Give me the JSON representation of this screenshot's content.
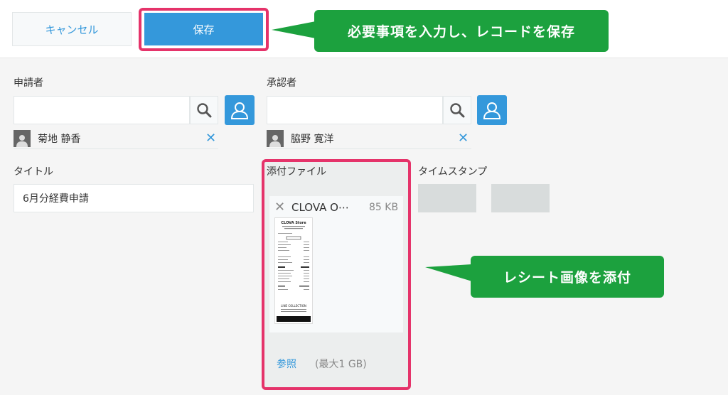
{
  "toolbar": {
    "cancel_label": "キャンセル",
    "save_label": "保存"
  },
  "callouts": {
    "save_note": "必要事項を入力し、レコードを保存",
    "receipt_note": "レシート画像を添付"
  },
  "fields": {
    "applicant": {
      "label": "申請者",
      "user": "菊地 静香"
    },
    "approver": {
      "label": "承認者",
      "user": "脇野 寛洋"
    },
    "title": {
      "label": "タイトル",
      "value": "6月分経費申請"
    },
    "attachment": {
      "label": "添付ファイル",
      "file_name": "CLOVA O⋯",
      "file_size": "85 KB",
      "browse_label": "参照",
      "max_size": "(最大1 GB)"
    },
    "timestamp": {
      "label": "タイムスタンプ"
    }
  },
  "receipt_image": {
    "store_logo": "CLOVA Store",
    "footer_text": "LINE COLLECTION"
  },
  "colors": {
    "accent": "#3498db",
    "highlight": "#e5336a",
    "callout": "#1ca13e"
  }
}
